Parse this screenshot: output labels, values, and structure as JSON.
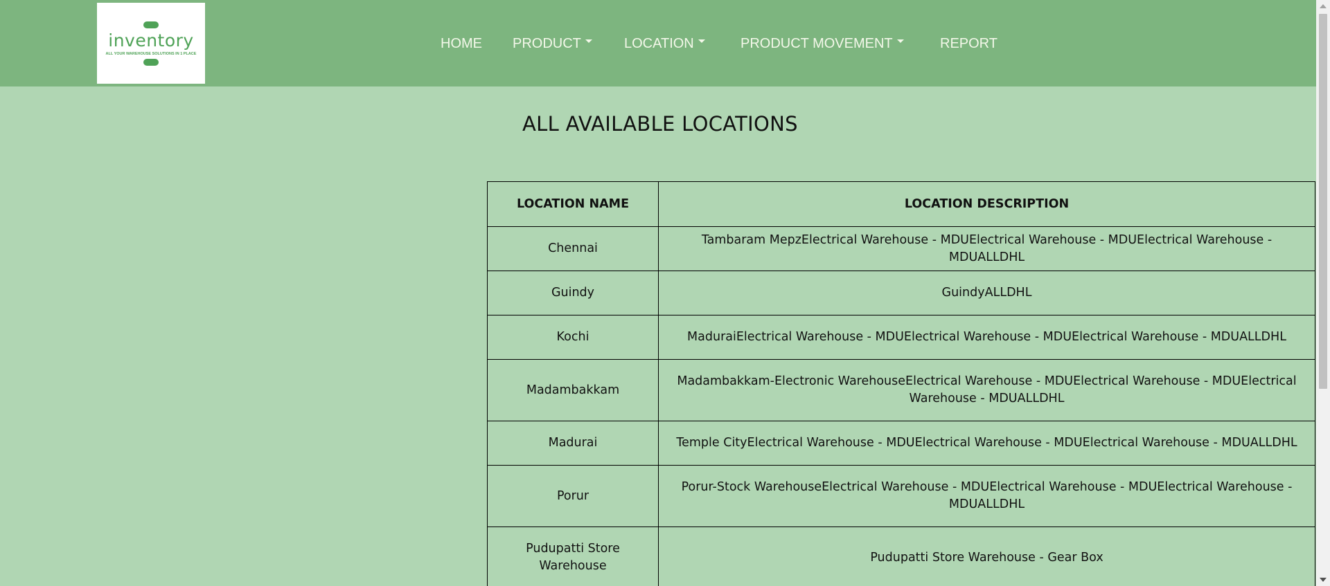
{
  "logo": {
    "word": "inventory",
    "tagline": "ALL YOUR WAREHOUSE SOLUTIONS IN 1 PLACE",
    "color": "#4fa257"
  },
  "nav": {
    "home": "HOME",
    "product": "PRODUCT",
    "location": "LOCATION",
    "product_movement": "PRODUCT MOVEMENT",
    "report": "REPORT"
  },
  "page": {
    "title": "ALL AVAILABLE LOCATIONS"
  },
  "table": {
    "headers": [
      "LOCATION NAME",
      "LOCATION DESCRIPTION"
    ],
    "rows": [
      {
        "name": "Chennai",
        "description": "Tambaram MepzElectrical Warehouse - MDUElectrical Warehouse - MDUElectrical Warehouse - MDUALLDHL"
      },
      {
        "name": "Guindy",
        "description": "GuindyALLDHL"
      },
      {
        "name": "Kochi",
        "description": "MaduraiElectrical Warehouse - MDUElectrical Warehouse - MDUElectrical Warehouse - MDUALLDHL"
      },
      {
        "name": "Madambakkam",
        "description": "Madambakkam-Electronic WarehouseElectrical Warehouse - MDUElectrical Warehouse - MDUElectrical Warehouse - MDUALLDHL"
      },
      {
        "name": "Madurai",
        "description": "Temple CityElectrical Warehouse - MDUElectrical Warehouse - MDUElectrical Warehouse - MDUALLDHL"
      },
      {
        "name": "Porur",
        "description": "Porur-Stock WarehouseElectrical Warehouse - MDUElectrical Warehouse - MDUElectrical Warehouse - MDUALLDHL"
      },
      {
        "name": "Pudupatti Store Warehouse",
        "description": "Pudupatti Store Warehouse - Gear Box"
      }
    ]
  },
  "colors": {
    "navbar": "#7db57f",
    "background": "#b0d6b3",
    "nav_text": "#f4f8ea"
  }
}
